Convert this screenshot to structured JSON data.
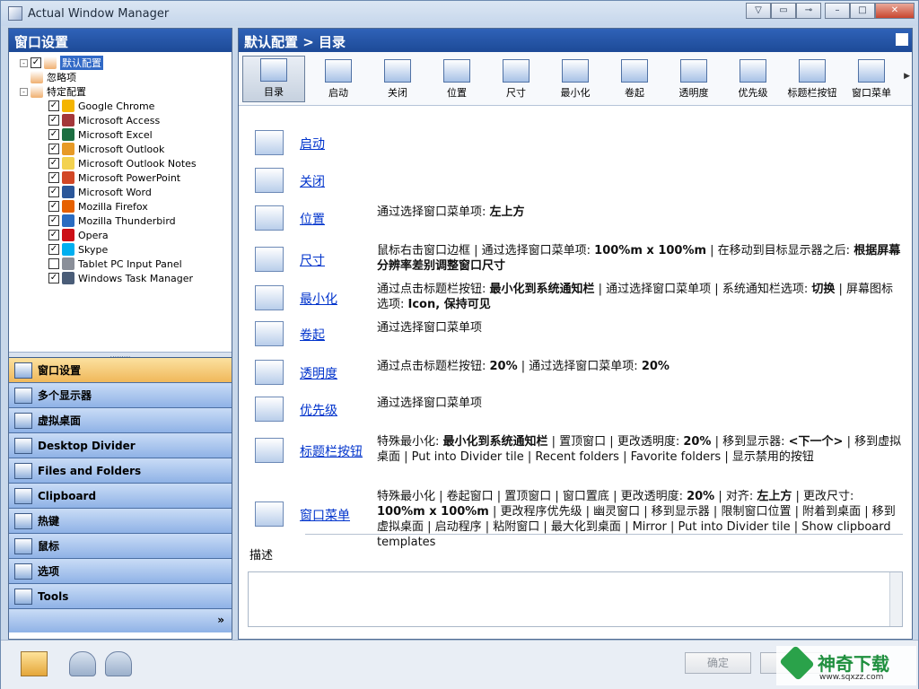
{
  "window": {
    "title": "Actual Window Manager"
  },
  "left": {
    "header": "窗口设置",
    "tree": [
      {
        "label": "默认配置",
        "level": 1,
        "checked": true,
        "selected": true,
        "expander": "-"
      },
      {
        "label": "忽略项",
        "level": 1,
        "checked": null,
        "selected": false,
        "expander": ""
      },
      {
        "label": "特定配置",
        "level": 1,
        "checked": null,
        "selected": false,
        "expander": "-"
      },
      {
        "label": "Google Chrome",
        "level": 2,
        "checked": true,
        "color": "#f4b400"
      },
      {
        "label": "Microsoft Access",
        "level": 2,
        "checked": true,
        "color": "#a4373a"
      },
      {
        "label": "Microsoft Excel",
        "level": 2,
        "checked": true,
        "color": "#1d6f42"
      },
      {
        "label": "Microsoft Outlook",
        "level": 2,
        "checked": true,
        "color": "#e79a26"
      },
      {
        "label": "Microsoft Outlook Notes",
        "level": 2,
        "checked": true,
        "color": "#f3d24f"
      },
      {
        "label": "Microsoft PowerPoint",
        "level": 2,
        "checked": true,
        "color": "#d24726"
      },
      {
        "label": "Microsoft Word",
        "level": 2,
        "checked": true,
        "color": "#2b579a"
      },
      {
        "label": "Mozilla Firefox",
        "level": 2,
        "checked": true,
        "color": "#e66000"
      },
      {
        "label": "Mozilla Thunderbird",
        "level": 2,
        "checked": true,
        "color": "#2a6cc1"
      },
      {
        "label": "Opera",
        "level": 2,
        "checked": true,
        "color": "#cc0f16"
      },
      {
        "label": "Skype",
        "level": 2,
        "checked": true,
        "color": "#00aff0"
      },
      {
        "label": "Tablet PC Input Panel",
        "level": 2,
        "checked": false,
        "color": "#8a8f99"
      },
      {
        "label": "Windows Task Manager",
        "level": 2,
        "checked": true,
        "color": "#4a5d78"
      }
    ],
    "nav": [
      {
        "label": "窗口设置",
        "active": true,
        "icon": "window-settings-icon"
      },
      {
        "label": "多个显示器",
        "active": false,
        "icon": "monitors-icon"
      },
      {
        "label": "虚拟桌面",
        "active": false,
        "icon": "virtual-desktop-icon"
      },
      {
        "label": "Desktop Divider",
        "active": false,
        "icon": "desktop-divider-icon"
      },
      {
        "label": "Files and Folders",
        "active": false,
        "icon": "folders-icon"
      },
      {
        "label": "Clipboard",
        "active": false,
        "icon": "clipboard-icon"
      },
      {
        "label": "热键",
        "active": false,
        "icon": "keyboard-icon"
      },
      {
        "label": "鼠标",
        "active": false,
        "icon": "mouse-icon"
      },
      {
        "label": "选项",
        "active": false,
        "icon": "options-icon"
      },
      {
        "label": "Tools",
        "active": false,
        "icon": "tools-icon"
      }
    ],
    "nav_more": "»"
  },
  "right": {
    "header": "默认配置 > 目录",
    "toolbar": [
      {
        "label": "目录",
        "icon": "directory-icon",
        "active": true
      },
      {
        "label": "启动",
        "icon": "startup-icon",
        "active": false
      },
      {
        "label": "关闭",
        "icon": "close-window-icon",
        "active": false
      },
      {
        "label": "位置",
        "icon": "position-icon",
        "active": false
      },
      {
        "label": "尺寸",
        "icon": "size-icon",
        "active": false
      },
      {
        "label": "最小化",
        "icon": "minimize-icon",
        "active": false
      },
      {
        "label": "卷起",
        "icon": "roll-up-icon",
        "active": false
      },
      {
        "label": "透明度",
        "icon": "transparency-icon",
        "active": false
      },
      {
        "label": "优先级",
        "icon": "priority-icon",
        "active": false
      },
      {
        "label": "标题栏按钮",
        "icon": "titlebar-buttons-icon",
        "active": false
      },
      {
        "label": "窗口菜单",
        "icon": "window-menu-icon",
        "active": false
      }
    ],
    "items": [
      {
        "link": "启动",
        "icon": "startup-icon",
        "desc": ""
      },
      {
        "link": "关闭",
        "icon": "close-window-icon",
        "desc": ""
      },
      {
        "link": "位置",
        "icon": "position-icon",
        "desc": "通过选择窗口菜单项: <b>左上方</b>"
      },
      {
        "link": "尺寸",
        "icon": "size-icon",
        "desc": "鼠标右击窗口边框 | 通过选择窗口菜单项: <b>100%m x 100%m</b> | 在移动到目标显示器之后: <b>根据屏幕分辨率差别调整窗口尺寸</b>"
      },
      {
        "link": "最小化",
        "icon": "minimize-icon",
        "desc": "通过点击标题栏按钮: <b>最小化到系统通知栏</b> | 通过选择窗口菜单项 | 系统通知栏选项: <b>切换</b> | 屏幕图标选项: <b>Icon, 保持可见</b>"
      },
      {
        "link": "卷起",
        "icon": "roll-up-icon",
        "desc": "通过选择窗口菜单项"
      },
      {
        "link": "透明度",
        "icon": "transparency-icon",
        "desc": "通过点击标题栏按钮: <b>20%</b> | 通过选择窗口菜单项: <b>20%</b>"
      },
      {
        "link": "优先级",
        "icon": "priority-icon",
        "desc": "通过选择窗口菜单项"
      },
      {
        "link": "标题栏按钮",
        "icon": "titlebar-buttons-icon",
        "desc": "特殊最小化: <b>最小化到系统通知栏</b> | 置顶窗口 | 更改透明度: <b>20%</b> | 移到显示器: <b>&lt;下一个&gt;</b> | 移到虚拟桌面 | Put into Divider tile | Recent folders | Favorite folders | 显示禁用的按钮"
      },
      {
        "link": "窗口菜单",
        "icon": "window-menu-icon",
        "desc": "特殊最小化 | 卷起窗口 | 置顶窗口 | 窗口置底 | 更改透明度: <b>20%</b> | 对齐: <b>左上方</b> | 更改尺寸: <b>100%m x 100%m</b> | 更改程序优先级 | 幽灵窗口 | 移到显示器 | 限制窗口位置 | 附着到桌面 | 移到虚拟桌面 | 启动程序 | 粘附窗口 | 最大化到桌面 | Mirror | Put into Divider tile | Show clipboard templates"
      }
    ],
    "desc_label": "描述"
  },
  "bottom": {
    "ok_label": "确定",
    "watermark_text": "神奇下载",
    "watermark_sub": "www.sqxzz.com"
  }
}
